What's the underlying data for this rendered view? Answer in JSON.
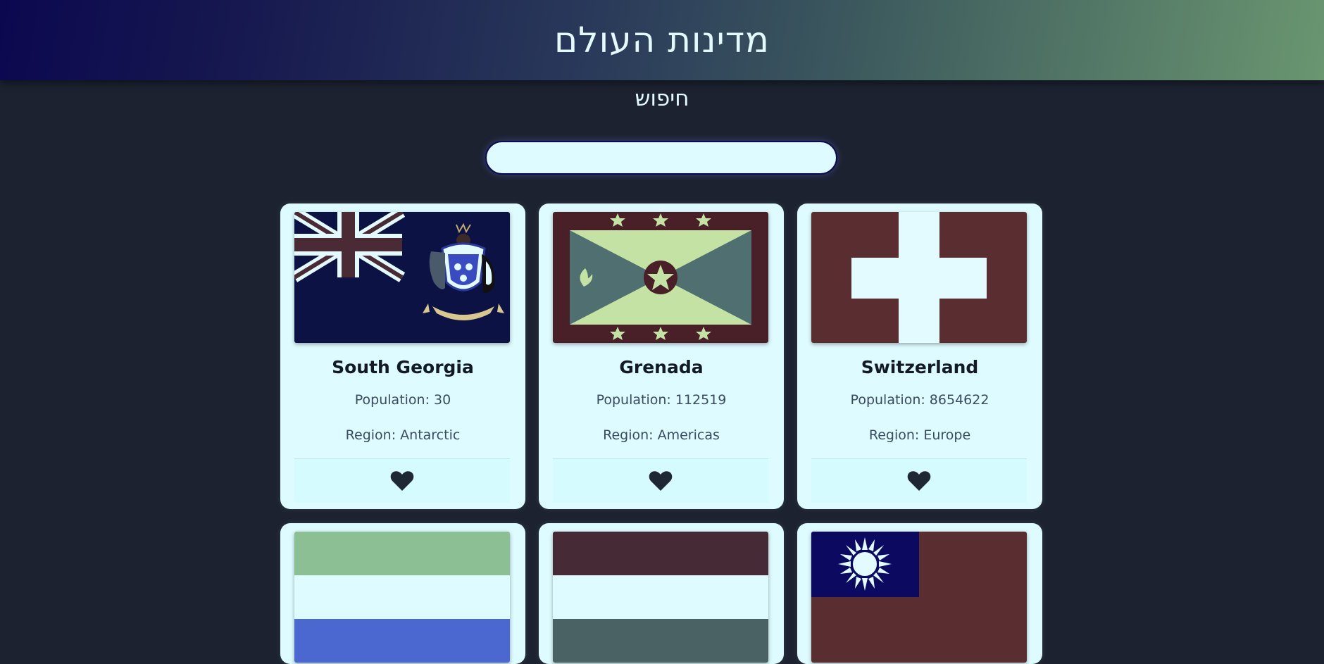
{
  "header": {
    "title": "מדינות העולם"
  },
  "search": {
    "heading": "חיפוש",
    "value": "",
    "placeholder": ""
  },
  "cards": [
    {
      "name": "South Georgia",
      "population": "Population: 30",
      "region": "Region: Antarctic",
      "flag_icon": "south-georgia-flag"
    },
    {
      "name": "Grenada",
      "population": "Population: 112519",
      "region": "Region: Americas",
      "flag_icon": "grenada-flag"
    },
    {
      "name": "Switzerland",
      "population": "Population: 8654622",
      "region": "Region: Europe",
      "flag_icon": "switzerland-flag"
    },
    {
      "name": "",
      "population": "",
      "region": "",
      "flag_icon": "sierra-leone-flag"
    },
    {
      "name": "",
      "population": "",
      "region": "",
      "flag_icon": "hungary-flag"
    },
    {
      "name": "",
      "population": "",
      "region": "",
      "flag_icon": "taiwan-flag"
    }
  ],
  "colors": {
    "background": "#1c2230",
    "card": "#defcff",
    "accent_dark": "#121a26"
  }
}
